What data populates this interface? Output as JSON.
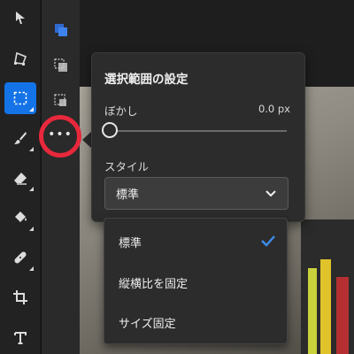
{
  "tools": [
    {
      "name": "move-tool",
      "icon": "arrow-cursor-icon"
    },
    {
      "name": "transform-tool",
      "icon": "transform-icon"
    },
    {
      "name": "selection-tool",
      "icon": "marquee-selection-icon",
      "active": true
    },
    {
      "name": "brush-tool",
      "icon": "brush-icon"
    },
    {
      "name": "eraser-tool",
      "icon": "eraser-icon"
    },
    {
      "name": "fill-tool",
      "icon": "paint-bucket-icon"
    },
    {
      "name": "heal-tool",
      "icon": "bandage-icon"
    },
    {
      "name": "crop-tool",
      "icon": "crop-icon"
    },
    {
      "name": "type-tool",
      "icon": "text-T-icon"
    }
  ],
  "subtools": [
    "selection-new-icon",
    "selection-add-icon",
    "selection-subtract-icon"
  ],
  "more_button": {
    "label": "•••",
    "highlight_color": "#e8283c"
  },
  "popover": {
    "title": "選択範囲の設定",
    "blur_label": "ぼかし",
    "blur_value": "0.0 px",
    "blur_level": 0,
    "style_label": "スタイル",
    "style_selected": "標準"
  },
  "menu": {
    "items": [
      {
        "label": "標準",
        "checked": true
      },
      {
        "label": "縦横比を固定",
        "checked": false
      },
      {
        "label": "サイズ固定",
        "checked": false
      }
    ]
  },
  "colors": {
    "accent": "#1473e6",
    "check": "#3d8ef0"
  }
}
